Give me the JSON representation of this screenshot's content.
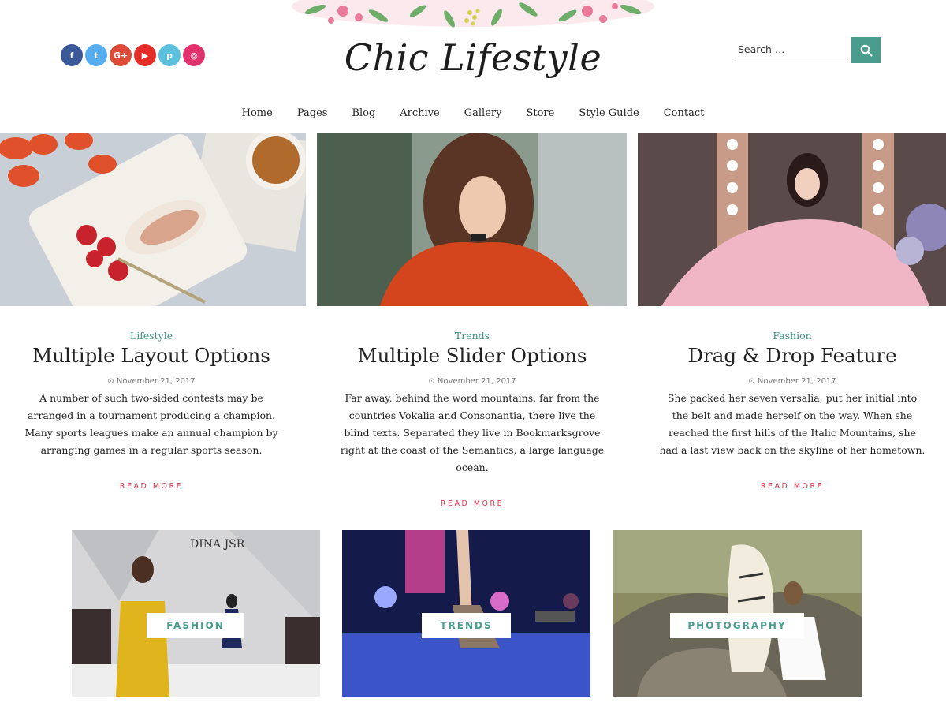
{
  "site": {
    "logo_text": "Chic Lifestyle"
  },
  "social": [
    {
      "icon": "facebook-icon",
      "glyph": "f",
      "color": "#3b5998"
    },
    {
      "icon": "twitter-icon",
      "glyph": "t",
      "color": "#55acee"
    },
    {
      "icon": "google-plus-icon",
      "glyph": "G+",
      "color": "#dd4b39"
    },
    {
      "icon": "youtube-icon",
      "glyph": "▶",
      "color": "#e52d27"
    },
    {
      "icon": "pinterest-icon",
      "glyph": "p",
      "color": "#5bc0de"
    },
    {
      "icon": "instagram-icon",
      "glyph": "◎",
      "color": "#e1306c"
    }
  ],
  "search": {
    "placeholder": "Search …",
    "button_icon": "search-icon"
  },
  "nav": [
    "Home",
    "Pages",
    "Blog",
    "Archive",
    "Gallery",
    "Store",
    "Style Guide",
    "Contact"
  ],
  "posts": [
    {
      "category": "Lifestyle",
      "title": "Multiple Layout Options",
      "date": "November 21, 2017",
      "excerpt": "A number of such two-sided contests may be arranged in a tournament producing a champion. Many sports leagues make an annual champion by arranging games in a regular sports season.",
      "read_more": "READ MORE"
    },
    {
      "category": "Trends",
      "title": "Multiple Slider Options",
      "date": "November 21, 2017",
      "excerpt": "Far away, behind the word mountains, far from the countries Vokalia and Consonantia, there live the blind texts. Separated they live in Bookmarksgrove right at the coast of the Semantics, a large language ocean.",
      "read_more": "READ MORE"
    },
    {
      "category": "Fashion",
      "title": "Drag & Drop Feature",
      "date": "November 21, 2017",
      "excerpt": "She packed her seven versalia, put her initial into the belt and made herself on the way. When she reached the first hills of the Italic Mountains, she had a last view back on the skyline of her hometown.",
      "read_more": "READ MORE"
    }
  ],
  "categories": [
    {
      "label": "FASHION",
      "image_text": "DINA JSR"
    },
    {
      "label": "TRENDS"
    },
    {
      "label": "PHOTOGRAPHY"
    }
  ],
  "colors": {
    "accent": "#4a9c8c",
    "read_more": "#d8344a"
  }
}
